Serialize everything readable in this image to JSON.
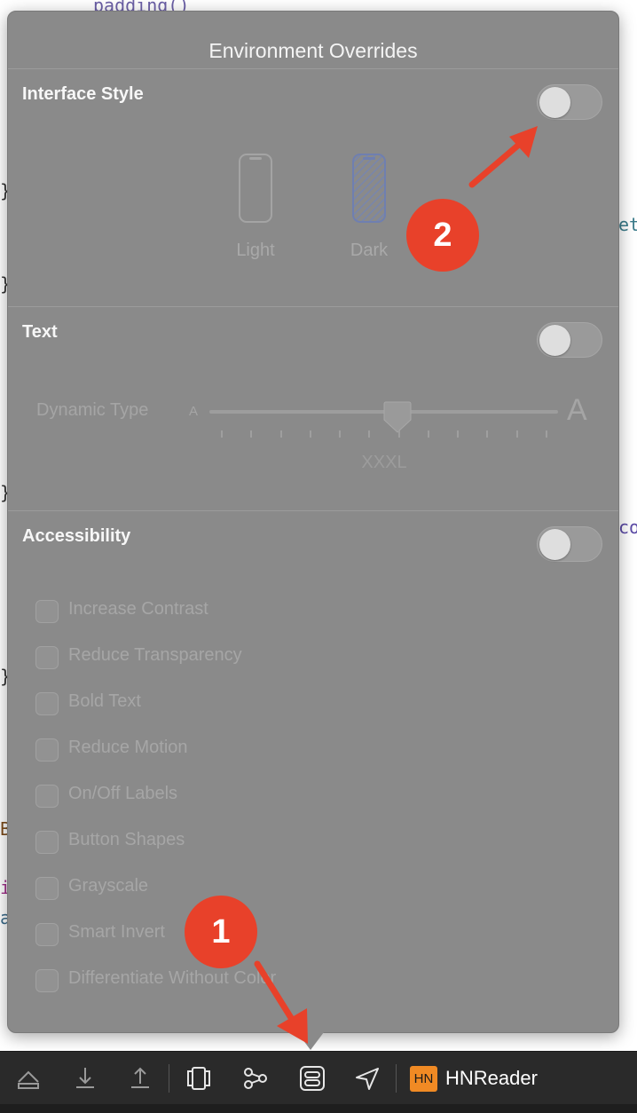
{
  "background_code": {
    "line1": "padding()",
    "brace": "}",
    "frag_et": "et",
    "frag_co": "co",
    "frag_b": "B",
    "frag_i": "i",
    "frag_a": "a"
  },
  "popover": {
    "title": "Environment Overrides",
    "interface_style": {
      "title": "Interface Style",
      "toggle_on": false,
      "options": [
        {
          "label": "Light",
          "icon": "iphone-light-icon"
        },
        {
          "label": "Dark",
          "icon": "iphone-dark-icon"
        }
      ]
    },
    "text": {
      "title": "Text",
      "toggle_on": false,
      "dynamic_type_label": "Dynamic Type",
      "small_a": "A",
      "large_a": "A",
      "size_value": "XXXL",
      "slider_fraction": 0.54,
      "tick_count": 12
    },
    "accessibility": {
      "title": "Accessibility",
      "toggle_on": false,
      "options": [
        "Increase Contrast",
        "Reduce Transparency",
        "Bold Text",
        "Reduce Motion",
        "On/Off Labels",
        "Button Shapes",
        "Grayscale",
        "Smart Invert",
        "Differentiate Without Color"
      ]
    }
  },
  "annotations": {
    "badge1": "1",
    "badge2": "2",
    "color": "#e8412a"
  },
  "toolbar": {
    "icons": [
      "hide-debug-area-icon",
      "step-over-icon",
      "step-out-icon",
      "view-debugger-icon",
      "memory-graph-icon",
      "environment-overrides-icon",
      "simulate-location-icon"
    ],
    "scheme_badge": "HN",
    "scheme_name": "HNReader"
  }
}
